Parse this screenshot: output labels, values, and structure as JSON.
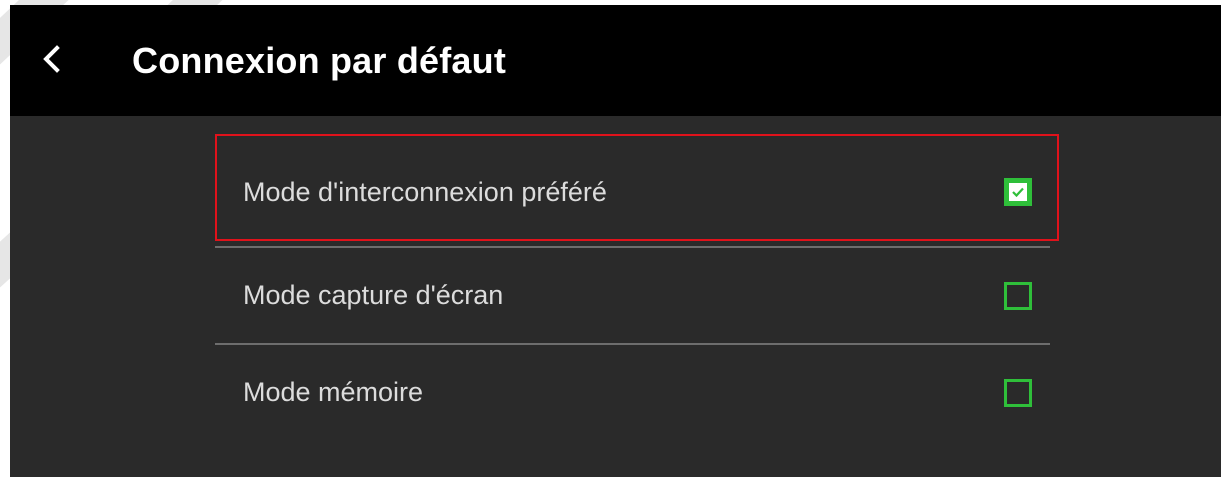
{
  "header": {
    "title": "Connexion par défaut",
    "back_icon": "chevron-left-icon"
  },
  "options": [
    {
      "label": "Mode d'interconnexion préféré",
      "checked": true
    },
    {
      "label": "Mode capture d'écran",
      "checked": false
    },
    {
      "label": "Mode mémoire",
      "checked": false
    }
  ],
  "colors": {
    "header_bg": "#000000",
    "content_bg": "#2a2a2a",
    "checkbox_accent": "#2fbf3a",
    "highlight_border": "#e0121b",
    "text": "#dcdcdc"
  }
}
